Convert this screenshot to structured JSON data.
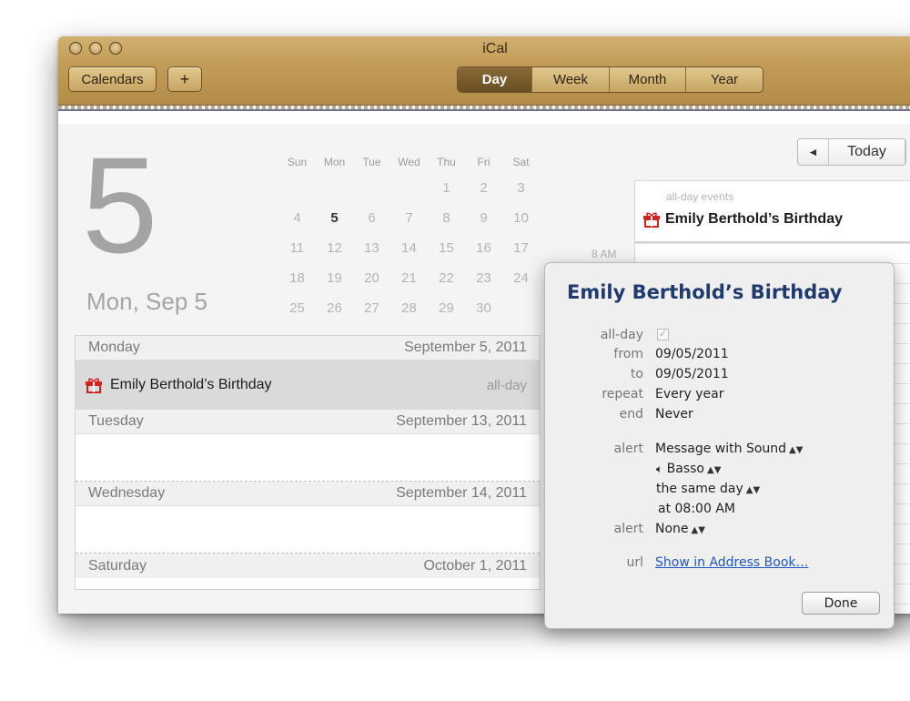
{
  "window": {
    "title": "iCal"
  },
  "toolbar": {
    "calendars_label": "Calendars",
    "add_label": "+",
    "views": [
      {
        "label": "Day",
        "active": true
      },
      {
        "label": "Week",
        "active": false
      },
      {
        "label": "Month",
        "active": false
      },
      {
        "label": "Year",
        "active": false
      }
    ]
  },
  "day_header": {
    "day_number": "5",
    "date_text": "Mon, Sep 5"
  },
  "mini_calendar": {
    "weekdays": [
      "Sun",
      "Mon",
      "Tue",
      "Wed",
      "Thu",
      "Fri",
      "Sat"
    ],
    "weeks": [
      [
        "",
        "",
        "",
        "",
        "1",
        "2",
        "3"
      ],
      [
        "4",
        "5",
        "6",
        "7",
        "8",
        "9",
        "10"
      ],
      [
        "11",
        "12",
        "13",
        "14",
        "15",
        "16",
        "17"
      ],
      [
        "18",
        "19",
        "20",
        "21",
        "22",
        "23",
        "24"
      ],
      [
        "25",
        "26",
        "27",
        "28",
        "29",
        "30",
        ""
      ]
    ],
    "today": "5"
  },
  "event_list": {
    "days": [
      {
        "weekday": "Monday",
        "date": "September 5, 2011"
      },
      {
        "weekday": "Tuesday",
        "date": "September 13, 2011"
      },
      {
        "weekday": "Wednesday",
        "date": "September 14, 2011"
      },
      {
        "weekday": "Saturday",
        "date": "October 1, 2011"
      }
    ],
    "event": {
      "name": "Emily Berthold’s Birthday",
      "tag": "all-day"
    }
  },
  "navigation": {
    "prev_label": "◄",
    "today_label": "Today"
  },
  "day_view": {
    "allday_label": "all-day events",
    "allday_event": "Emily Berthold’s Birthday",
    "hour_label": "8 AM"
  },
  "popover": {
    "title": "Emily Berthold’s Birthday",
    "labels": {
      "allday": "all-day",
      "from": "from",
      "to": "to",
      "repeat": "repeat",
      "end": "end",
      "alert": "alert",
      "alert2": "alert",
      "url": "url"
    },
    "allday_check": "✓",
    "from": "09/05/2011",
    "to": "09/05/2011",
    "repeat": "Every year",
    "end": "Never",
    "alert_type": "Message with Sound",
    "alert_sound": "Basso",
    "alert_when": "the same day",
    "alert_time": "at 08:00 AM",
    "alert2": "None",
    "url": "Show in Address Book…",
    "done_label": "Done"
  }
}
